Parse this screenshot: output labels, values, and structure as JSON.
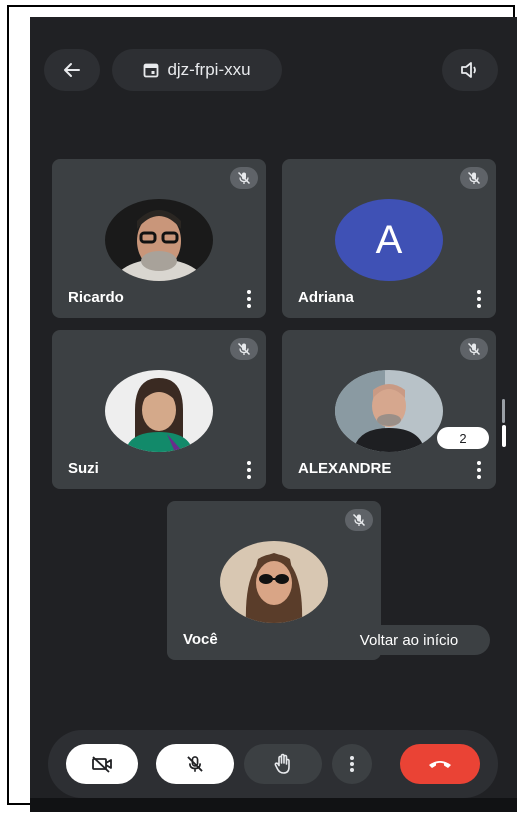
{
  "meeting": {
    "code": "djz-frpi-xxu"
  },
  "tiles": [
    {
      "name": "Ricardo",
      "avatar_letter": ""
    },
    {
      "name": "Adriana",
      "avatar_letter": "A"
    },
    {
      "name": "Suzi",
      "avatar_letter": ""
    },
    {
      "name": "ALEXANDRE",
      "avatar_letter": ""
    },
    {
      "name": "Você",
      "avatar_letter": ""
    }
  ],
  "overflow_badge": "2",
  "toast": "Voltar ao início",
  "colors": {
    "background": "#202124",
    "tile": "#3c4043",
    "avatar_a": "#3f51b5",
    "end_call": "#ea4335"
  },
  "icons": [
    "back-arrow-icon",
    "calendar-icon",
    "speaker-icon",
    "mic-off-icon",
    "more-vert-icon",
    "camera-off-icon",
    "raise-hand-icon",
    "end-call-icon"
  ]
}
